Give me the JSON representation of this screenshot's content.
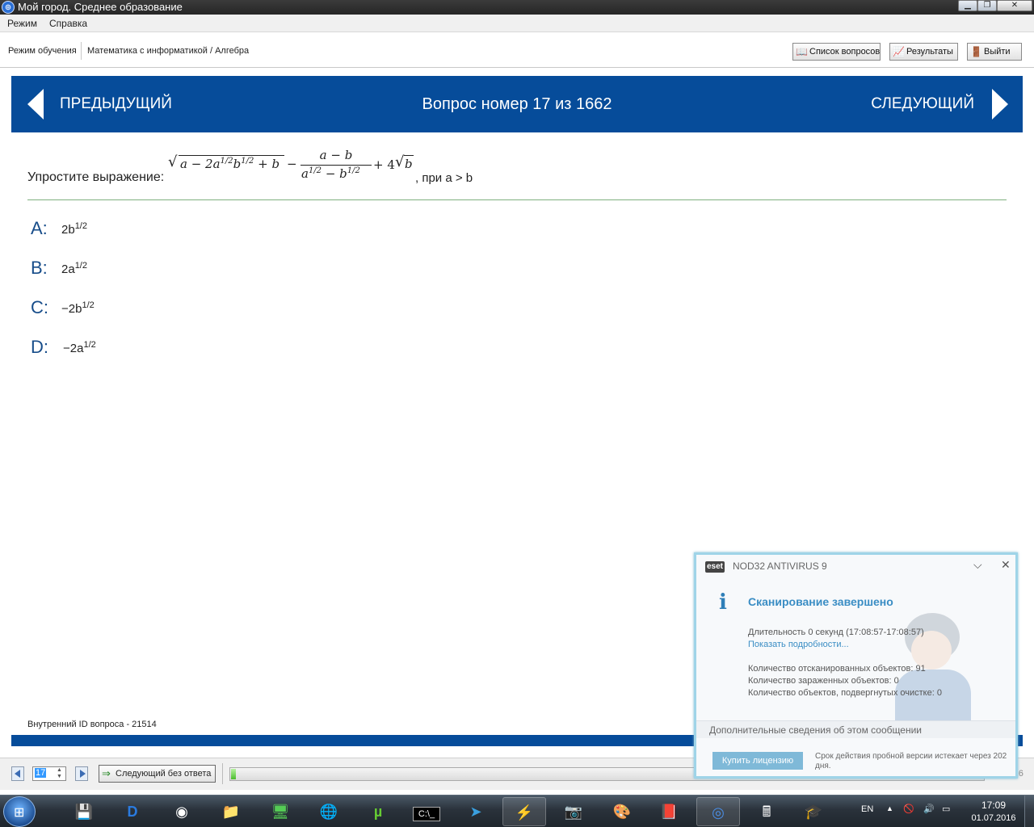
{
  "window": {
    "title": "Мой город. Среднее образование",
    "icon": "app-globe-icon",
    "controls": {
      "minimize": "minimize-icon",
      "maximize": "maximize-icon",
      "close": "close-icon"
    }
  },
  "menu": [
    "Режим",
    "Справка"
  ],
  "toolbar": {
    "mode": "Режим обучения",
    "breadcrumb": "Математика с информатикой / Алгебра",
    "buttons": {
      "questions": "Список вопросов",
      "results": "Результаты",
      "exit": "Выйти"
    }
  },
  "nav": {
    "prev": "ПРЕДЫДУЩИЙ",
    "title": "Вопрос номер 17 из 1662",
    "next": "СЛЕДУЮЩИЙ"
  },
  "question": {
    "prompt": "Упростите выражение:",
    "condition": ", при a > b",
    "formula": {
      "sqrt_body": "a − 2a",
      "sqrt_exp1": "1/2",
      "sqrt_mid": "b",
      "sqrt_exp2": "1/2",
      "sqrt_tail": "+ b",
      "minus": "−",
      "numerator": "a − b",
      "den_a": "a",
      "den_exp1": "1/2",
      "den_mid": " − b",
      "den_exp2": "1/2",
      "plus": "+ 4",
      "sqrt2_body": "b"
    },
    "answers": [
      {
        "letter": "A:",
        "base": "2b",
        "exp": "1/2"
      },
      {
        "letter": "B:",
        "base": "2a",
        "exp": "1/2"
      },
      {
        "letter": "C:",
        "base": "−2b",
        "exp": "1/2"
      },
      {
        "letter": "D:",
        "base": "−2a",
        "exp": "1/2"
      }
    ],
    "internal_id": "Внутренний ID вопроса - 21514"
  },
  "bottom": {
    "question_number": "17",
    "skip_button": "Следующий без ответа",
    "timer": "02:59:26"
  },
  "eset": {
    "logo": "eset",
    "product": "NOD32 ANTIVIRUS 9",
    "heading": "Сканирование завершено",
    "duration": "Длительность 0 секунд (17:08:57-17:08:57)",
    "details_link": "Показать подробности...",
    "scanned": "Количество отсканированных объектов: 91",
    "infected": "Количество зараженных объектов: 0",
    "cleaned": "Количество объектов, подвергнутых очистке: 0",
    "more_info": "Дополнительные сведения об этом сообщении",
    "buy_button": "Купить лицензию",
    "trial_notice": "Срок действия пробной версии истекает через 202 дня."
  },
  "taskbar": {
    "apps": [
      "start-orb",
      "floppy-app",
      "dfile-app",
      "chrome-app",
      "explorer-app",
      "monitor-app",
      "globe-download-app",
      "utorrent-app",
      "cmd-app",
      "telegram-app",
      "winamp-app",
      "camera-app",
      "paint-app",
      "red-book-app",
      "moygorod-app",
      "calculator-app",
      "graduation-app"
    ],
    "lang": "EN",
    "time": "17:09",
    "date": "01.07.2016"
  }
}
